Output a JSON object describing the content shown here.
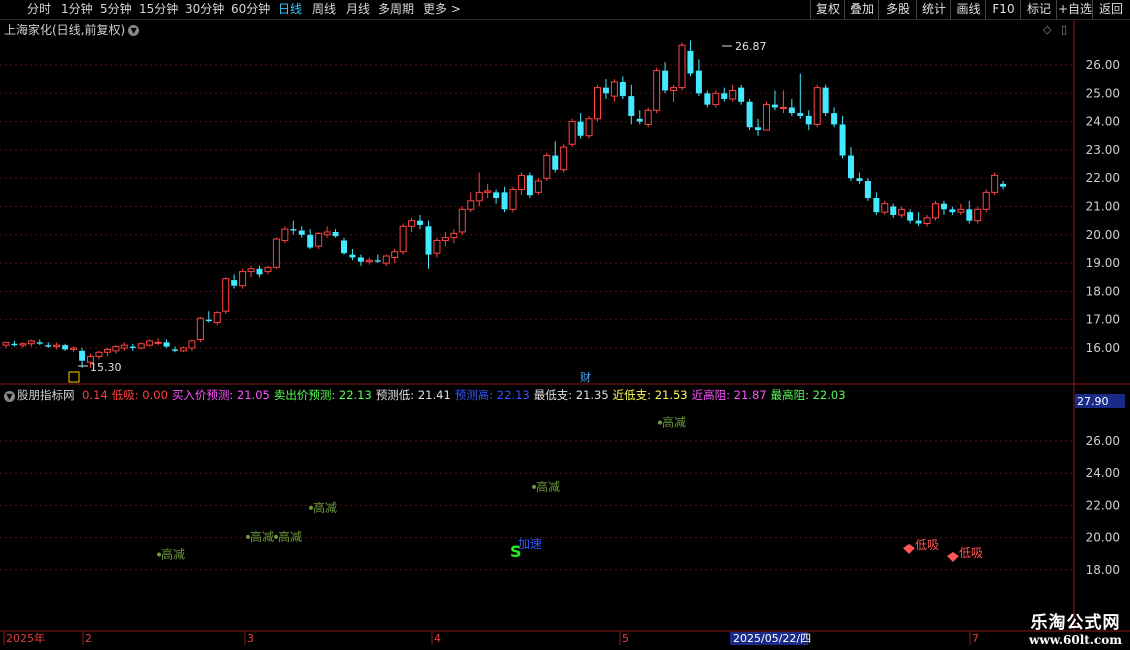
{
  "toolbar": {
    "periods": [
      "分时",
      "1分钟",
      "5分钟",
      "15分钟",
      "30分钟",
      "60分钟",
      "日线",
      "周线",
      "月线",
      "多周期",
      "更多 >"
    ],
    "active_period": "日线",
    "right_buttons": [
      "复权",
      "叠加",
      "多股",
      "统计",
      "画线",
      "F10",
      "标记",
      "+自选",
      "返回"
    ]
  },
  "main_chart": {
    "title": "上海家化(日线,前复权)",
    "high_label": "26.87",
    "low_label": "15.30",
    "cai_label": "财",
    "y_ticks": [
      "26.00",
      "25.00",
      "24.00",
      "23.00",
      "22.00",
      "21.00",
      "20.00",
      "19.00",
      "18.00",
      "17.00",
      "16.00"
    ]
  },
  "indicator": {
    "name": "股朋指标网",
    "items": [
      {
        "label": "",
        "value": "0.14",
        "color": "#ff4040"
      },
      {
        "label": "低吸:",
        "value": "0.00",
        "color": "#ff4040"
      },
      {
        "label": "买入价预测:",
        "value": "21.05",
        "color": "#ff55ff"
      },
      {
        "label": "卖出价预测:",
        "value": "22.13",
        "color": "#55ff55"
      },
      {
        "label": "预测低:",
        "value": "21.41",
        "color": "#e0e0e0"
      },
      {
        "label": "预测高:",
        "value": "22.13",
        "color": "#3355ff"
      },
      {
        "label": "最低支:",
        "value": "21.35",
        "color": "#e0e0e0"
      },
      {
        "label": "近低支:",
        "value": "21.53",
        "color": "#ffff55"
      },
      {
        "label": "近高阻:",
        "value": "21.87",
        "color": "#ff55ff"
      },
      {
        "label": "最高阻:",
        "value": "22.03",
        "color": "#55ff55"
      }
    ],
    "current_value": "27.90",
    "y_ticks": [
      "26.00",
      "24.00",
      "22.00",
      "20.00",
      "18.00"
    ],
    "signals": [
      {
        "text": "高减",
        "x": 161,
        "y": 18.7
      },
      {
        "text": "高减",
        "x": 250,
        "y": 19.8
      },
      {
        "text": "高减",
        "x": 278,
        "y": 19.8
      },
      {
        "text": "高减",
        "x": 313,
        "y": 21.6
      },
      {
        "text": "高减",
        "x": 536,
        "y": 22.9
      },
      {
        "text": "高减",
        "x": 662,
        "y": 26.9
      }
    ],
    "s_marker": "S",
    "add_label": "加速",
    "low_buy_labels": [
      "低吸",
      "低吸"
    ]
  },
  "time_axis": {
    "labels": [
      "2025年",
      "2",
      "3",
      "4",
      "5",
      "2025/05/22/四",
      "7"
    ]
  },
  "watermark": {
    "line1": "乐淘公式网",
    "line2": "www.60lt.com"
  },
  "chart_data": {
    "type": "candlestick",
    "y_range": [
      15.3,
      26.87
    ],
    "candles": [
      [
        16.1,
        16.2,
        16.0,
        16.2
      ],
      [
        16.15,
        16.25,
        16.05,
        16.1
      ],
      [
        16.1,
        16.2,
        16.0,
        16.15
      ],
      [
        16.15,
        16.3,
        16.05,
        16.25
      ],
      [
        16.2,
        16.3,
        16.1,
        16.15
      ],
      [
        16.1,
        16.2,
        16.0,
        16.05
      ],
      [
        16.05,
        16.2,
        15.95,
        16.1
      ],
      [
        16.1,
        16.15,
        15.9,
        15.95
      ],
      [
        15.95,
        16.05,
        15.85,
        16.0
      ],
      [
        15.9,
        16.0,
        15.3,
        15.55
      ],
      [
        15.5,
        15.8,
        15.3,
        15.7
      ],
      [
        15.7,
        15.9,
        15.6,
        15.85
      ],
      [
        15.85,
        16.0,
        15.7,
        15.95
      ],
      [
        15.9,
        16.1,
        15.8,
        16.05
      ],
      [
        16.0,
        16.2,
        15.9,
        16.1
      ],
      [
        16.05,
        16.15,
        15.9,
        16.0
      ],
      [
        16.0,
        16.2,
        15.95,
        16.15
      ],
      [
        16.1,
        16.3,
        16.05,
        16.25
      ],
      [
        16.2,
        16.35,
        16.1,
        16.2
      ],
      [
        16.2,
        16.3,
        16.0,
        16.05
      ],
      [
        15.95,
        16.05,
        15.85,
        15.9
      ],
      [
        15.9,
        16.05,
        15.85,
        16.0
      ],
      [
        16.0,
        16.3,
        15.9,
        16.25
      ],
      [
        16.3,
        17.1,
        16.2,
        17.05
      ],
      [
        17.0,
        17.3,
        16.9,
        16.95
      ],
      [
        16.9,
        17.3,
        16.8,
        17.25
      ],
      [
        17.3,
        18.5,
        17.2,
        18.45
      ],
      [
        18.4,
        18.6,
        18.1,
        18.2
      ],
      [
        18.2,
        18.8,
        18.1,
        18.7
      ],
      [
        18.7,
        18.9,
        18.5,
        18.8
      ],
      [
        18.8,
        18.9,
        18.5,
        18.6
      ],
      [
        18.7,
        18.9,
        18.6,
        18.85
      ],
      [
        18.85,
        19.9,
        18.8,
        19.85
      ],
      [
        19.8,
        20.3,
        19.7,
        20.2
      ],
      [
        20.2,
        20.5,
        20.0,
        20.15
      ],
      [
        20.15,
        20.3,
        19.9,
        20.0
      ],
      [
        20.0,
        20.2,
        19.5,
        19.55
      ],
      [
        19.6,
        20.1,
        19.5,
        20.05
      ],
      [
        20.0,
        20.3,
        19.9,
        20.1
      ],
      [
        20.1,
        20.2,
        19.9,
        19.95
      ],
      [
        19.8,
        19.9,
        19.3,
        19.35
      ],
      [
        19.3,
        19.5,
        19.1,
        19.2
      ],
      [
        19.2,
        19.3,
        18.9,
        19.05
      ],
      [
        19.05,
        19.2,
        18.95,
        19.1
      ],
      [
        19.1,
        19.3,
        19.0,
        19.05
      ],
      [
        19.0,
        19.3,
        18.9,
        19.25
      ],
      [
        19.2,
        19.5,
        19.0,
        19.4
      ],
      [
        19.4,
        20.4,
        19.3,
        20.3
      ],
      [
        20.3,
        20.6,
        20.1,
        20.5
      ],
      [
        20.5,
        20.7,
        20.2,
        20.35
      ],
      [
        20.3,
        20.5,
        18.8,
        19.3
      ],
      [
        19.35,
        19.9,
        19.2,
        19.8
      ],
      [
        19.8,
        20.1,
        19.6,
        19.9
      ],
      [
        19.9,
        20.2,
        19.7,
        20.05
      ],
      [
        20.1,
        21.0,
        20.0,
        20.9
      ],
      [
        20.9,
        21.5,
        20.8,
        21.2
      ],
      [
        21.2,
        22.2,
        21.0,
        21.5
      ],
      [
        21.5,
        21.8,
        21.3,
        21.55
      ],
      [
        21.5,
        21.6,
        21.1,
        21.3
      ],
      [
        21.5,
        21.7,
        20.8,
        20.9
      ],
      [
        20.9,
        21.7,
        20.8,
        21.6
      ],
      [
        21.6,
        22.2,
        21.4,
        22.1
      ],
      [
        22.1,
        22.2,
        21.3,
        21.4
      ],
      [
        21.5,
        22.0,
        21.4,
        21.9
      ],
      [
        22.0,
        22.9,
        21.9,
        22.8
      ],
      [
        22.8,
        23.3,
        22.2,
        22.3
      ],
      [
        22.3,
        23.2,
        22.2,
        23.1
      ],
      [
        23.2,
        24.1,
        23.1,
        24.0
      ],
      [
        24.0,
        24.3,
        23.4,
        23.5
      ],
      [
        23.5,
        24.2,
        23.4,
        24.1
      ],
      [
        24.1,
        25.3,
        24.0,
        25.2
      ],
      [
        25.2,
        25.5,
        24.8,
        25.0
      ],
      [
        24.9,
        25.5,
        24.7,
        25.4
      ],
      [
        25.4,
        25.6,
        24.8,
        24.9
      ],
      [
        24.9,
        25.3,
        23.9,
        24.2
      ],
      [
        24.1,
        24.4,
        23.9,
        24.0
      ],
      [
        23.9,
        24.5,
        23.8,
        24.4
      ],
      [
        24.4,
        25.9,
        24.3,
        25.8
      ],
      [
        25.8,
        26.1,
        25.0,
        25.1
      ],
      [
        25.1,
        25.3,
        24.7,
        25.2
      ],
      [
        25.2,
        26.8,
        25.1,
        26.7
      ],
      [
        26.5,
        26.87,
        25.6,
        25.7
      ],
      [
        25.8,
        26.2,
        24.9,
        25.0
      ],
      [
        25.0,
        25.1,
        24.5,
        24.6
      ],
      [
        24.6,
        25.1,
        24.5,
        25.0
      ],
      [
        25.0,
        25.2,
        24.7,
        24.8
      ],
      [
        24.8,
        25.3,
        24.7,
        25.1
      ],
      [
        25.2,
        25.3,
        24.6,
        24.7
      ],
      [
        24.7,
        24.8,
        23.7,
        23.8
      ],
      [
        23.8,
        24.1,
        23.5,
        23.7
      ],
      [
        23.7,
        24.7,
        23.7,
        24.6
      ],
      [
        24.6,
        25.1,
        24.4,
        24.5
      ],
      [
        24.5,
        25.1,
        24.3,
        24.5
      ],
      [
        24.5,
        24.8,
        24.2,
        24.3
      ],
      [
        24.3,
        25.7,
        24.1,
        24.2
      ],
      [
        24.2,
        24.4,
        23.7,
        23.9
      ],
      [
        23.9,
        25.3,
        23.8,
        25.2
      ],
      [
        25.2,
        25.3,
        24.2,
        24.3
      ],
      [
        24.3,
        24.5,
        23.8,
        23.9
      ],
      [
        23.9,
        24.2,
        22.7,
        22.8
      ],
      [
        22.8,
        23.1,
        21.9,
        22.0
      ],
      [
        22.0,
        22.2,
        21.8,
        21.9
      ],
      [
        21.9,
        22.0,
        21.2,
        21.3
      ],
      [
        21.3,
        21.5,
        20.7,
        20.8
      ],
      [
        20.8,
        21.2,
        20.7,
        21.1
      ],
      [
        21.0,
        21.1,
        20.6,
        20.7
      ],
      [
        20.7,
        21.0,
        20.6,
        20.9
      ],
      [
        20.8,
        20.9,
        20.4,
        20.5
      ],
      [
        20.5,
        20.8,
        20.3,
        20.4
      ],
      [
        20.4,
        20.7,
        20.3,
        20.6
      ],
      [
        20.6,
        21.2,
        20.5,
        21.1
      ],
      [
        21.1,
        21.2,
        20.7,
        20.9
      ],
      [
        20.9,
        21.0,
        20.7,
        20.8
      ],
      [
        20.8,
        21.1,
        20.7,
        20.9
      ],
      [
        20.9,
        21.2,
        20.4,
        20.5
      ],
      [
        20.5,
        21.0,
        20.4,
        20.9
      ],
      [
        20.9,
        21.6,
        20.8,
        21.5
      ],
      [
        21.5,
        22.2,
        21.4,
        22.1
      ],
      [
        21.8,
        21.9,
        21.6,
        21.7
      ]
    ]
  }
}
